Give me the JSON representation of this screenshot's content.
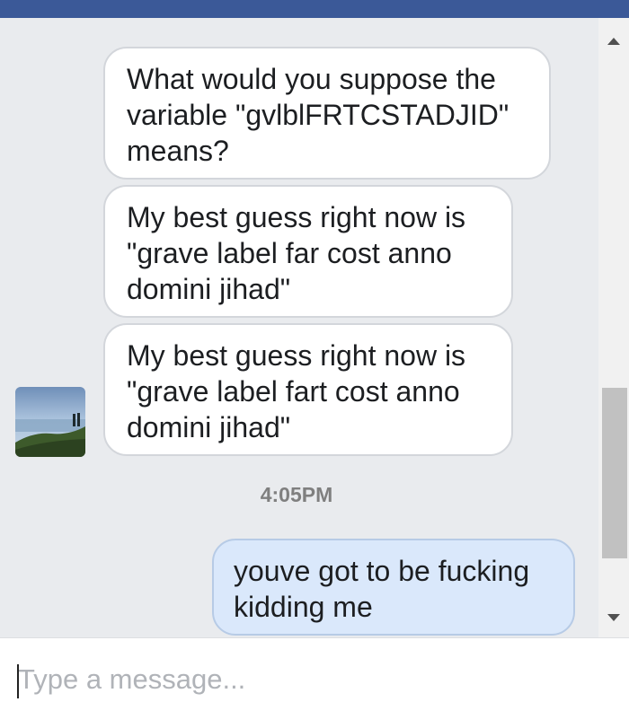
{
  "messages": [
    {
      "direction": "incoming",
      "text": "What would you suppose the\nvariable \"gvlblFRTCSTADJID\"\nmeans?"
    },
    {
      "direction": "incoming",
      "text": "My best guess right now is\n\"grave label far cost anno\ndomini jihad\""
    },
    {
      "direction": "incoming",
      "text": "My best guess right now is\n\"grave label fart cost anno\ndomini jihad\""
    },
    {
      "direction": "outgoing",
      "text": "youve got to be fucking\nkidding me"
    }
  ],
  "timestamp": "4:05PM",
  "composer": {
    "placeholder": "Type a message..."
  },
  "colors": {
    "header": "#3b5998",
    "chat_background": "#e9ebee",
    "incoming_bubble": "#ffffff",
    "outgoing_bubble": "#dae8fb",
    "timestamp_text": "#7f7f7f"
  },
  "icons": {
    "scroll_up": "triangle-up-icon",
    "scroll_down": "triangle-down-icon"
  }
}
